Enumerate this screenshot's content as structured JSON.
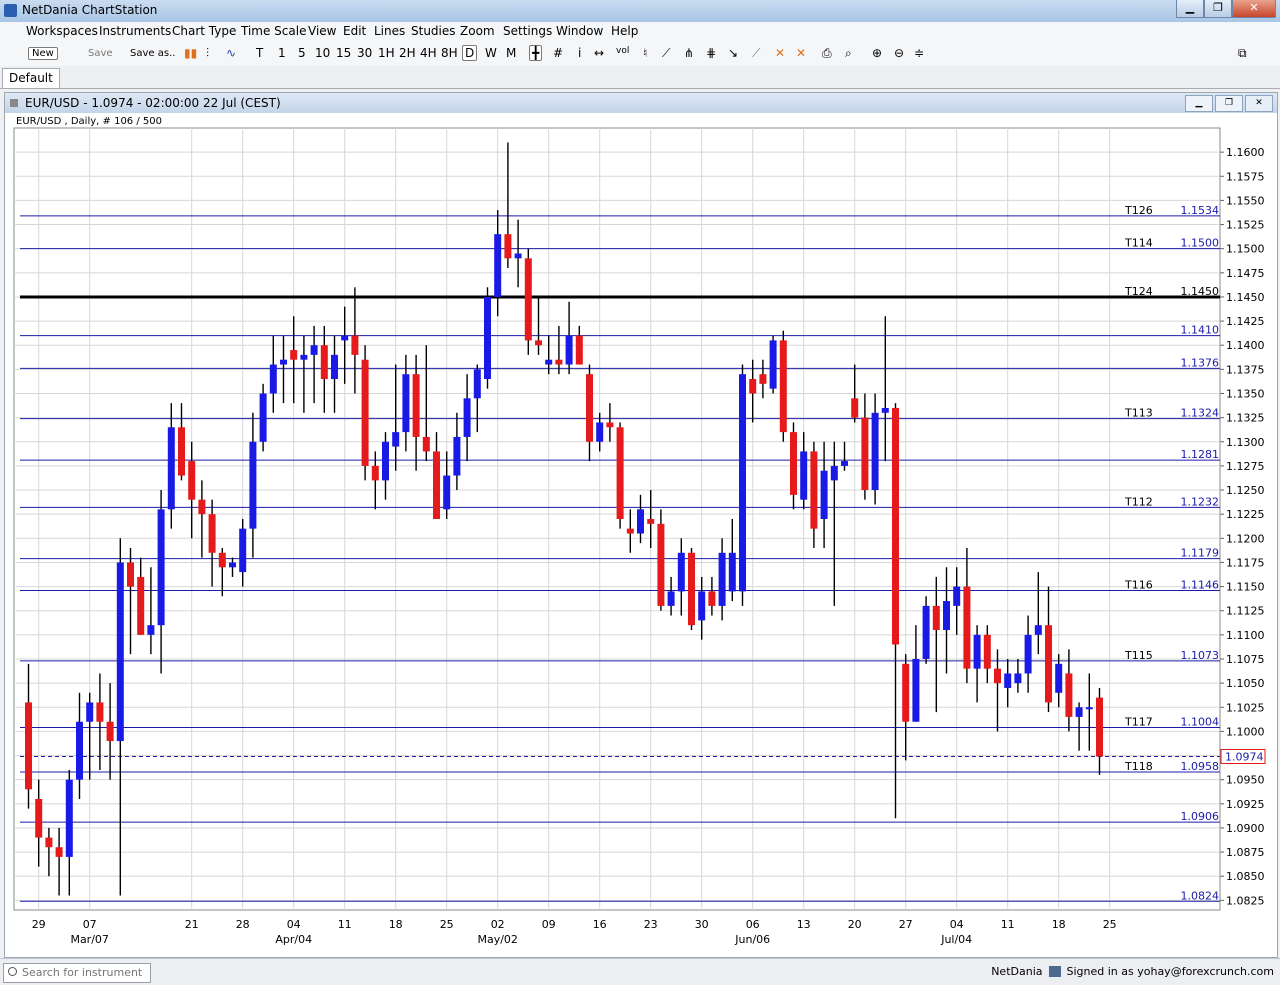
{
  "window": {
    "title": "NetDania ChartStation"
  },
  "menu": [
    "Workspaces",
    "Instruments",
    "Chart Type",
    "Time Scale",
    "View",
    "Edit",
    "Lines",
    "Studies",
    "Zoom",
    "Settings",
    "Window",
    "Help"
  ],
  "toolbar": {
    "new_label": "New",
    "save_label": "Save",
    "saveas_label": "Save as..",
    "timeframes": [
      "T",
      "1",
      "5",
      "10",
      "15",
      "30",
      "1H",
      "2H",
      "4H",
      "8H",
      "D",
      "W",
      "M"
    ],
    "active_timeframe": "D",
    "info_label": "i",
    "vol_label": "vol"
  },
  "tabs": [
    {
      "label": "Default"
    }
  ],
  "chart_window": {
    "title": "EUR/USD - 1.0974 - 02:00:00  22 Jul (CEST)",
    "subtitle": "EUR/USD , Daily, # 106 / 500"
  },
  "chart_data": {
    "type": "candlestick",
    "symbol": "EUR/USD",
    "ylim": [
      1.0815,
      1.1625
    ],
    "yticks": [
      "1.1600",
      "1.1575",
      "1.1550",
      "1.1525",
      "1.1500",
      "1.1475",
      "1.1450",
      "1.1425",
      "1.1400",
      "1.1375",
      "1.1350",
      "1.1325",
      "1.1300",
      "1.1275",
      "1.1250",
      "1.1225",
      "1.1200",
      "1.1175",
      "1.1150",
      "1.1125",
      "1.1100",
      "1.1075",
      "1.1050",
      "1.1025",
      "1.1000",
      "1.0975",
      "1.0950",
      "1.0925",
      "1.0900",
      "1.0875",
      "1.0850",
      "1.0825"
    ],
    "xticks": [
      {
        "index": 1,
        "label": "29",
        "sub": ""
      },
      {
        "index": 6,
        "label": "07",
        "sub": "Mar/07"
      },
      {
        "index": 16,
        "label": "21",
        "sub": ""
      },
      {
        "index": 21,
        "label": "28",
        "sub": ""
      },
      {
        "index": 26,
        "label": "04",
        "sub": "Apr/04"
      },
      {
        "index": 31,
        "label": "11",
        "sub": ""
      },
      {
        "index": 36,
        "label": "18",
        "sub": ""
      },
      {
        "index": 41,
        "label": "25",
        "sub": ""
      },
      {
        "index": 46,
        "label": "02",
        "sub": "May/02"
      },
      {
        "index": 51,
        "label": "09",
        "sub": ""
      },
      {
        "index": 56,
        "label": "16",
        "sub": ""
      },
      {
        "index": 61,
        "label": "23",
        "sub": ""
      },
      {
        "index": 66,
        "label": "30",
        "sub": ""
      },
      {
        "index": 71,
        "label": "06",
        "sub": "Jun/06"
      },
      {
        "index": 76,
        "label": "13",
        "sub": ""
      },
      {
        "index": 81,
        "label": "20",
        "sub": ""
      },
      {
        "index": 86,
        "label": "27",
        "sub": ""
      },
      {
        "index": 91,
        "label": "04",
        "sub": "Jul/04"
      },
      {
        "index": 96,
        "label": "11",
        "sub": ""
      },
      {
        "index": 101,
        "label": "18",
        "sub": ""
      },
      {
        "index": 106,
        "label": "25",
        "sub": ""
      }
    ],
    "level_lines": [
      {
        "value": 1.1534,
        "label": "T126",
        "price": "1.1534",
        "bold": false
      },
      {
        "value": 1.15,
        "label": "T114",
        "price": "1.1500",
        "bold": false
      },
      {
        "value": 1.145,
        "label": "T124",
        "price": "1.1450",
        "bold": true
      },
      {
        "value": 1.141,
        "label": "",
        "price": "1.1410",
        "bold": false
      },
      {
        "value": 1.1376,
        "label": "",
        "price": "1.1376",
        "bold": false
      },
      {
        "value": 1.1324,
        "label": "T113",
        "price": "1.1324",
        "bold": false
      },
      {
        "value": 1.1281,
        "label": "",
        "price": "1.1281",
        "bold": false
      },
      {
        "value": 1.1232,
        "label": "T112",
        "price": "1.1232",
        "bold": false
      },
      {
        "value": 1.1179,
        "label": "",
        "price": "1.1179",
        "bold": false
      },
      {
        "value": 1.1146,
        "label": "T116",
        "price": "1.1146",
        "bold": false
      },
      {
        "value": 1.1073,
        "label": "T115",
        "price": "1.1073",
        "bold": false
      },
      {
        "value": 1.1004,
        "label": "T117",
        "price": "1.1004",
        "bold": false
      },
      {
        "value": 1.0958,
        "label": "T118",
        "price": "1.0958",
        "bold": false
      },
      {
        "value": 1.0906,
        "label": "",
        "price": "1.0906",
        "bold": false
      },
      {
        "value": 1.0824,
        "label": "",
        "price": "1.0824",
        "bold": false
      }
    ],
    "current_price": {
      "value": 1.0974,
      "label": "1.0974"
    },
    "colors": {
      "up": "#1a1ae6",
      "down": "#e61a1a",
      "line": "#1c1ca8",
      "bold": "#000000",
      "grid": "#d7d7d7"
    },
    "candles": [
      [
        1.103,
        1.107,
        1.092,
        1.094
      ],
      [
        1.093,
        1.095,
        1.086,
        1.089
      ],
      [
        1.089,
        1.09,
        1.085,
        1.088
      ],
      [
        1.088,
        1.09,
        1.083,
        1.087
      ],
      [
        1.087,
        1.096,
        1.083,
        1.095
      ],
      [
        1.095,
        1.104,
        1.093,
        1.101
      ],
      [
        1.101,
        1.104,
        1.095,
        1.103
      ],
      [
        1.103,
        1.106,
        1.096,
        1.101
      ],
      [
        1.101,
        1.105,
        1.095,
        1.099
      ],
      [
        1.099,
        1.12,
        1.083,
        1.1175
      ],
      [
        1.1175,
        1.119,
        1.108,
        1.115
      ],
      [
        1.116,
        1.118,
        1.11,
        1.11
      ],
      [
        1.11,
        1.117,
        1.108,
        1.111
      ],
      [
        1.111,
        1.125,
        1.106,
        1.123
      ],
      [
        1.123,
        1.134,
        1.121,
        1.1315
      ],
      [
        1.1315,
        1.134,
        1.126,
        1.1265
      ],
      [
        1.128,
        1.13,
        1.12,
        1.124
      ],
      [
        1.124,
        1.126,
        1.118,
        1.1225
      ],
      [
        1.1225,
        1.124,
        1.115,
        1.1185
      ],
      [
        1.1185,
        1.119,
        1.114,
        1.117
      ],
      [
        1.117,
        1.118,
        1.116,
        1.1175
      ],
      [
        1.1165,
        1.122,
        1.115,
        1.121
      ],
      [
        1.121,
        1.133,
        1.118,
        1.13
      ],
      [
        1.13,
        1.136,
        1.129,
        1.135
      ],
      [
        1.135,
        1.141,
        1.133,
        1.138
      ],
      [
        1.138,
        1.141,
        1.134,
        1.1385
      ],
      [
        1.1395,
        1.143,
        1.134,
        1.1385
      ],
      [
        1.1385,
        1.141,
        1.133,
        1.139
      ],
      [
        1.139,
        1.142,
        1.134,
        1.14
      ],
      [
        1.14,
        1.142,
        1.133,
        1.1365
      ],
      [
        1.1365,
        1.141,
        1.133,
        1.139
      ],
      [
        1.1405,
        1.144,
        1.136,
        1.141
      ],
      [
        1.141,
        1.146,
        1.135,
        1.139
      ],
      [
        1.1385,
        1.14,
        1.126,
        1.1275
      ],
      [
        1.1275,
        1.129,
        1.123,
        1.126
      ],
      [
        1.126,
        1.131,
        1.124,
        1.13
      ],
      [
        1.1295,
        1.138,
        1.127,
        1.131
      ],
      [
        1.131,
        1.139,
        1.129,
        1.137
      ],
      [
        1.137,
        1.139,
        1.127,
        1.1305
      ],
      [
        1.1305,
        1.14,
        1.128,
        1.129
      ],
      [
        1.129,
        1.131,
        1.122,
        1.122
      ],
      [
        1.123,
        1.129,
        1.122,
        1.1265
      ],
      [
        1.1265,
        1.133,
        1.125,
        1.1305
      ],
      [
        1.1305,
        1.137,
        1.128,
        1.1345
      ],
      [
        1.1345,
        1.138,
        1.131,
        1.1375
      ],
      [
        1.1365,
        1.146,
        1.1355,
        1.145
      ],
      [
        1.145,
        1.154,
        1.143,
        1.1515
      ],
      [
        1.1515,
        1.161,
        1.148,
        1.149
      ],
      [
        1.149,
        1.153,
        1.146,
        1.1495
      ],
      [
        1.149,
        1.15,
        1.139,
        1.1405
      ],
      [
        1.1405,
        1.145,
        1.139,
        1.14
      ],
      [
        1.138,
        1.141,
        1.137,
        1.1385
      ],
      [
        1.1385,
        1.142,
        1.137,
        1.138
      ],
      [
        1.138,
        1.1445,
        1.137,
        1.141
      ],
      [
        1.141,
        1.142,
        1.138,
        1.138
      ],
      [
        1.137,
        1.138,
        1.128,
        1.13
      ],
      [
        1.13,
        1.133,
        1.129,
        1.132
      ],
      [
        1.132,
        1.134,
        1.13,
        1.1315
      ],
      [
        1.1315,
        1.132,
        1.121,
        1.122
      ],
      [
        1.121,
        1.123,
        1.1185,
        1.1205
      ],
      [
        1.1205,
        1.1245,
        1.1195,
        1.123
      ],
      [
        1.122,
        1.125,
        1.119,
        1.1215
      ],
      [
        1.1215,
        1.123,
        1.1125,
        1.113
      ],
      [
        1.113,
        1.116,
        1.112,
        1.1145
      ],
      [
        1.1145,
        1.12,
        1.112,
        1.1185
      ],
      [
        1.1185,
        1.119,
        1.1105,
        1.111
      ],
      [
        1.1115,
        1.116,
        1.1095,
        1.1145
      ],
      [
        1.1145,
        1.116,
        1.112,
        1.113
      ],
      [
        1.113,
        1.12,
        1.1115,
        1.1185
      ],
      [
        1.1145,
        1.122,
        1.1135,
        1.1185
      ],
      [
        1.1145,
        1.138,
        1.113,
        1.137
      ],
      [
        1.1365,
        1.1385,
        1.132,
        1.135
      ],
      [
        1.137,
        1.1385,
        1.1345,
        1.136
      ],
      [
        1.1355,
        1.141,
        1.135,
        1.1405
      ],
      [
        1.1405,
        1.1415,
        1.13,
        1.131
      ],
      [
        1.131,
        1.132,
        1.123,
        1.1245
      ],
      [
        1.124,
        1.131,
        1.123,
        1.129
      ],
      [
        1.129,
        1.13,
        1.119,
        1.121
      ],
      [
        1.122,
        1.13,
        1.119,
        1.127
      ],
      [
        1.126,
        1.13,
        1.113,
        1.1275
      ],
      [
        1.1275,
        1.13,
        1.127,
        1.128
      ],
      [
        1.1345,
        1.138,
        1.132,
        1.1325
      ],
      [
        1.1325,
        1.135,
        1.124,
        1.125
      ],
      [
        1.125,
        1.135,
        1.1235,
        1.133
      ],
      [
        1.133,
        1.143,
        1.128,
        1.1335
      ],
      [
        1.1335,
        1.134,
        1.091,
        1.109
      ],
      [
        1.107,
        1.108,
        1.097,
        1.101
      ],
      [
        1.101,
        1.111,
        1.101,
        1.1075
      ],
      [
        1.1075,
        1.114,
        1.107,
        1.113
      ],
      [
        1.113,
        1.116,
        1.102,
        1.1105
      ],
      [
        1.1105,
        1.117,
        1.106,
        1.1135
      ],
      [
        1.113,
        1.117,
        1.11,
        1.115
      ],
      [
        1.115,
        1.119,
        1.105,
        1.1065
      ],
      [
        1.1065,
        1.111,
        1.103,
        1.11
      ],
      [
        1.11,
        1.111,
        1.105,
        1.1065
      ],
      [
        1.1065,
        1.1085,
        1.1,
        1.105
      ],
      [
        1.1045,
        1.1075,
        1.1025,
        1.106
      ],
      [
        1.105,
        1.1075,
        1.104,
        1.106
      ],
      [
        1.106,
        1.112,
        1.104,
        1.11
      ],
      [
        1.11,
        1.1165,
        1.108,
        1.111
      ],
      [
        1.111,
        1.115,
        1.102,
        1.103
      ],
      [
        1.104,
        1.108,
        1.1025,
        1.107
      ],
      [
        1.106,
        1.1085,
        1.1,
        1.1015
      ],
      [
        1.1015,
        1.103,
        1.098,
        1.1025
      ],
      [
        1.1025,
        1.106,
        1.098,
        1.1025
      ],
      [
        1.1035,
        1.1045,
        1.0955,
        1.0974
      ]
    ]
  },
  "search": {
    "placeholder": "Search for instrument"
  },
  "status": {
    "brand": "NetDania",
    "signed_in": "Signed in as yohay@forexcrunch.com"
  }
}
